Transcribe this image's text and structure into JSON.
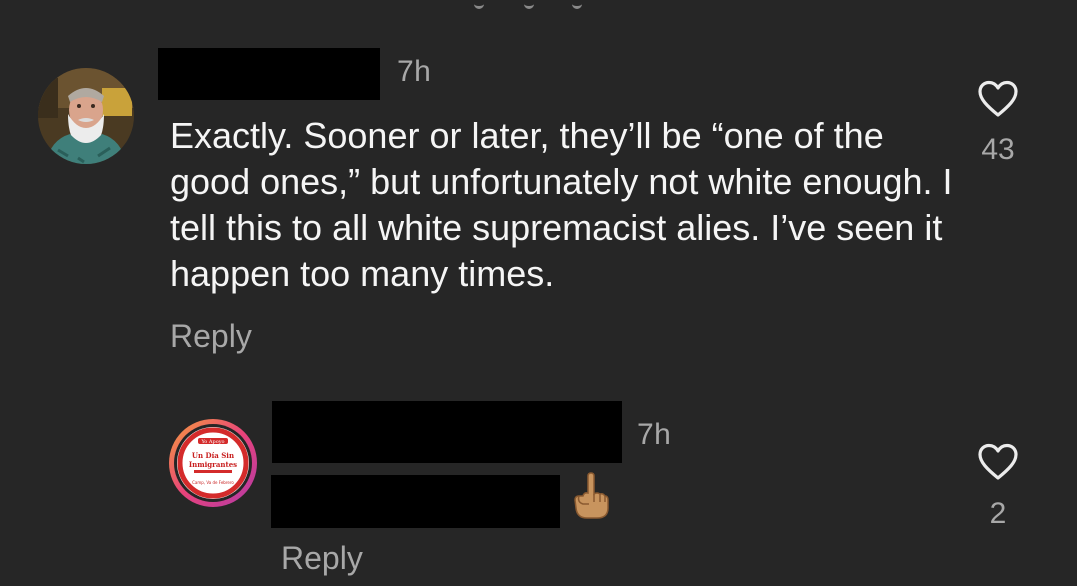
{
  "comments": [
    {
      "time": "7h",
      "text": "Exactly. Sooner or later, they’ll be “one of the good ones,” but unfortunately not white enough. I tell this to all white supremacist alies. I’ve seen it happen too many times.",
      "reply_label": "Reply",
      "likes": "43",
      "avatar": "profile-photo-bearded-man"
    },
    {
      "time": "7h",
      "reply_label": "Reply",
      "likes": "2",
      "emoji": "index-pointing-up",
      "avatar": {
        "top_text": "Yo Apoyo",
        "main_text_1": "Un Día Sin",
        "main_text_2": "Inmigrantes",
        "bottom_text": "Camp, Va de Febrero"
      }
    }
  ],
  "colors": {
    "background": "#262626",
    "text_primary": "#f5f5f5",
    "text_secondary": "#a8a8a8",
    "redaction": "#000000",
    "badge_ring": "#e8437a"
  }
}
